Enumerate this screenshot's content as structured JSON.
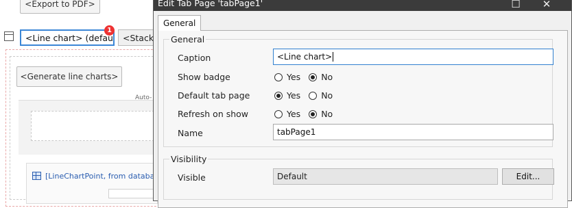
{
  "designer": {
    "export_pdf_label": "<Export to PDF>",
    "tabs": [
      {
        "label": "<Line chart> (default)",
        "active": true
      },
      {
        "label": "<Stacke",
        "active": false
      }
    ],
    "badge_count": "1",
    "generate_button_label": "<Generate line charts>",
    "auto_label": "Auto-",
    "datasource_label": "[LineChartPoint, from database"
  },
  "dialog": {
    "title": "Edit Tab Page 'tabPage1'",
    "window_buttons": {
      "maximize": "☐",
      "close": "✕"
    },
    "tab_label": "General",
    "general_group": {
      "title": "General",
      "caption_label": "Caption",
      "caption_value": "<Line chart>",
      "show_badge_label": "Show badge",
      "show_badge_selected": "No",
      "default_tab_label": "Default tab page",
      "default_tab_selected": "Yes",
      "refresh_label": "Refresh on show",
      "refresh_selected": "No",
      "name_label": "Name",
      "name_value": "tabPage1"
    },
    "visibility_group": {
      "title": "Visibility",
      "visible_label": "Visible",
      "visible_value": "Default",
      "edit_button_label": "Edit..."
    },
    "yes_label": "Yes",
    "no_label": "No"
  }
}
